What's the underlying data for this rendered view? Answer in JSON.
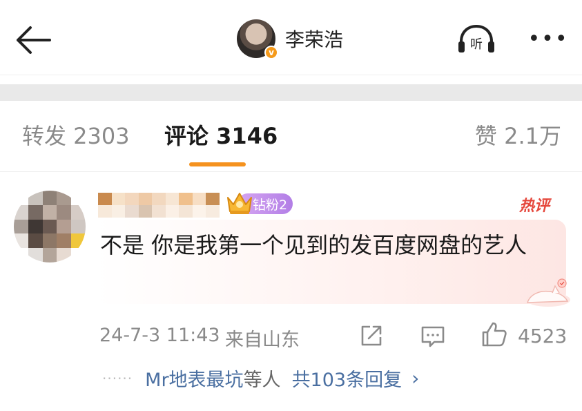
{
  "header": {
    "title": "李荣浩",
    "verified_badge": "v",
    "listen_label": "听",
    "more_label": "•••"
  },
  "tabs": {
    "repost": "转发 2303",
    "comment": "评论 3146",
    "like": "赞 2.1万",
    "active": "comment",
    "accent_color": "#f5921e"
  },
  "comment": {
    "fan_badge": "钻粉2",
    "hot_tag": "热评",
    "text": "不是 你是我第一个见到的发百度网盘的艺人",
    "time": "24-7-3 11:43",
    "location": "来自山东",
    "like_count": "4523",
    "replies": {
      "dots": "······",
      "user": "Mr地表最坑",
      "etc": "等人",
      "count": "共103条回复",
      "chevron": "›"
    }
  },
  "icons": [
    "back-arrow-icon",
    "listen-headphones-icon",
    "more-dots-icon",
    "crown-icon",
    "share-icon",
    "comment-icon",
    "thumbs-up-icon",
    "cat-decoration-icon"
  ],
  "colors": {
    "link": "#4a6fa1",
    "hot": "#e5473c",
    "fan_badge": "#b27ee6",
    "verified": "#f59a1b"
  }
}
